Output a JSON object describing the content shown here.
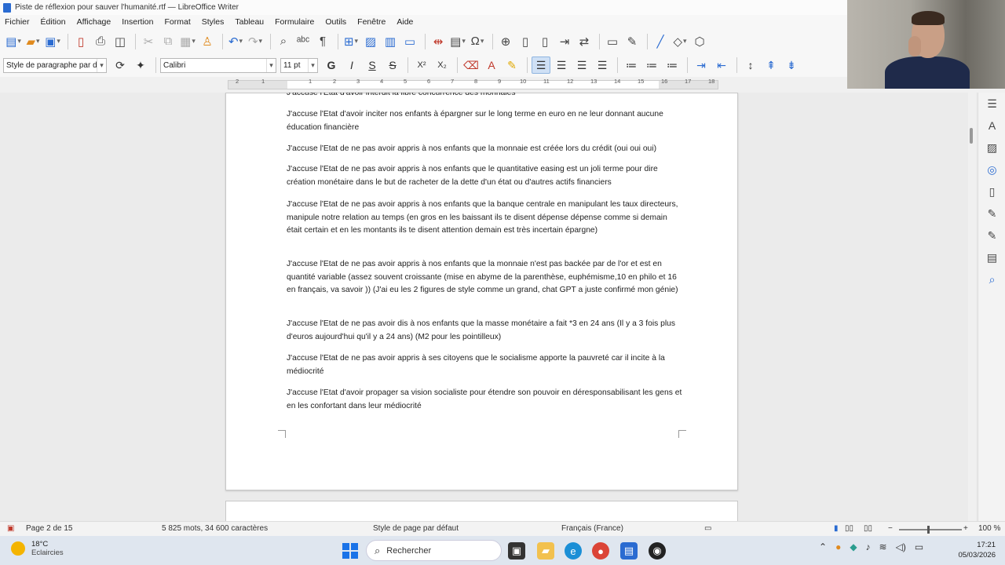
{
  "window": {
    "title": "Piste de réflexion pour sauver l'humanité.rtf — LibreOffice Writer"
  },
  "menu": [
    "Fichier",
    "Édition",
    "Affichage",
    "Insertion",
    "Format",
    "Styles",
    "Tableau",
    "Formulaire",
    "Outils",
    "Fenêtre",
    "Aide"
  ],
  "formatting": {
    "paragraph_style": "Style de paragraphe par défaut",
    "font_name": "Calibri",
    "font_size": "11 pt",
    "bold": "G",
    "italic": "I",
    "underline": "S",
    "strike": "S",
    "superscript": "X²",
    "subscript": "X₂"
  },
  "ruler": {
    "ticks": [
      "2",
      "1",
      "1",
      "2",
      "3",
      "4",
      "5",
      "6",
      "7",
      "8",
      "9",
      "10",
      "11",
      "12",
      "13",
      "14",
      "15",
      "16",
      "17",
      "18"
    ]
  },
  "document": {
    "paragraphs": [
      "J'accuse l'Etat d'avoir interdit la libre concurrence des monnaies",
      "J'accuse l'Etat d'avoir inciter nos enfants à épargner sur le long terme en euro en ne leur donnant aucune éducation financière",
      "J'accuse l'Etat de ne pas avoir appris à nos enfants que la monnaie est créée lors du crédit (oui oui oui)",
      "J'accuse l'Etat de ne pas avoir appris à nos enfants que le quantitative easing est un joli terme pour dire création monétaire dans le but de racheter de la dette d'un état ou d'autres actifs financiers",
      "J'accuse l'Etat de ne pas avoir appris à nos enfants que la banque centrale en manipulant les taux directeurs, manipule notre relation au temps (en gros en les baissant ils te disent dépense dépense comme si demain était certain et en les montants ils te disent attention demain est très incertain épargne)",
      "J'accuse l'Etat de ne pas avoir appris à nos enfants que la monnaie n'est pas backée par de l'or et est en quantité variable (assez souvent croissante (mise en abyme de la parenthèse, euphémisme,10 en philo et 16 en français, va savoir )) (J'ai eu les 2 figures de style comme un grand, chat GPT a juste confirmé mon génie)",
      "J'accuse l'Etat de ne pas avoir dis à nos enfants que la masse monétaire a fait *3 en 24 ans (Il y a 3 fois plus d'euros aujourd'hui qu'il y a 24 ans) (M2 pour les pointilleux)",
      "J'accuse l'Etat de ne pas avoir appris à ses citoyens que le socialisme apporte la pauvreté car il incite à la médiocrité",
      "J'accuse l'Etat d'avoir propager sa vision socialiste pour étendre son pouvoir en déresponsabilisant les gens et en les confortant dans leur médiocrité"
    ]
  },
  "status": {
    "page": "Page 2 de 15",
    "words": "5 825 mots, 34 600 caractères",
    "page_style": "Style de page par défaut",
    "language": "Français (France)",
    "zoom": "100 %"
  },
  "taskbar": {
    "temperature": "18°C",
    "weather": "Eclaircies",
    "search_placeholder": "Rechercher",
    "time": "17:21",
    "date": "05/03/2026"
  },
  "colors": {
    "accent": "#2a6bd1",
    "font_color": "#c0392b",
    "highlight": "#f5c518"
  }
}
